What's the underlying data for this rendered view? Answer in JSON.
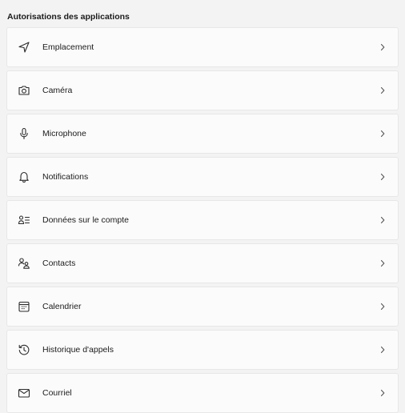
{
  "section": {
    "title": "Autorisations des applications"
  },
  "items": [
    {
      "label": "Emplacement",
      "icon": "location-arrow-icon"
    },
    {
      "label": "Caméra",
      "icon": "camera-icon"
    },
    {
      "label": "Microphone",
      "icon": "microphone-icon"
    },
    {
      "label": "Notifications",
      "icon": "bell-icon"
    },
    {
      "label": "Données sur le compte",
      "icon": "account-info-icon"
    },
    {
      "label": "Contacts",
      "icon": "contacts-icon"
    },
    {
      "label": "Calendrier",
      "icon": "calendar-icon"
    },
    {
      "label": "Historique d'appels",
      "icon": "call-history-icon"
    },
    {
      "label": "Courriel",
      "icon": "mail-icon"
    }
  ],
  "colors": {
    "background": "#f3f3f3",
    "card": "#fbfbfb",
    "border": "#e7e7e7",
    "text": "#1b1b1b"
  }
}
